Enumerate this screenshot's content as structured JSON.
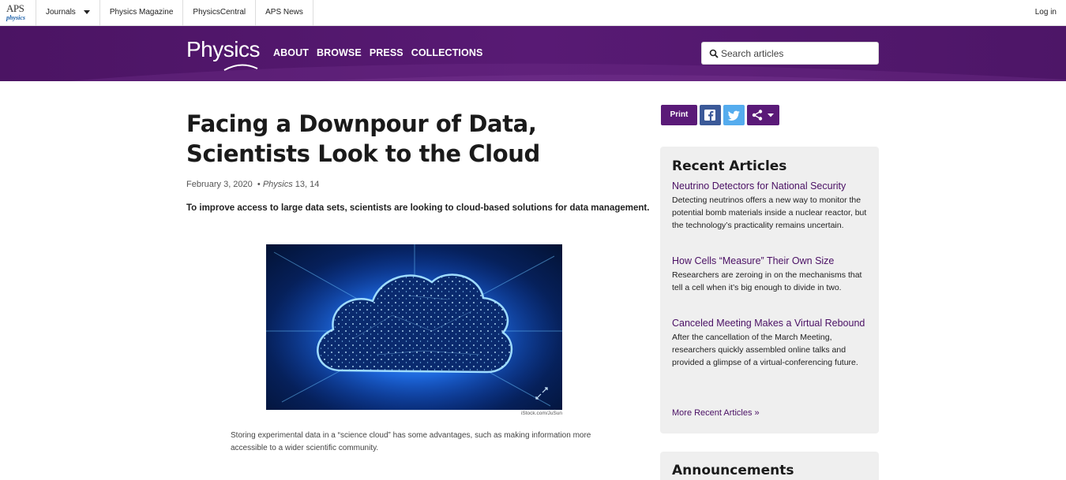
{
  "topbar": {
    "logo_aps": "APS",
    "logo_sub": "physics",
    "nav": [
      "Journals",
      "Physics Magazine",
      "PhysicsCentral",
      "APS News"
    ],
    "login": "Log in"
  },
  "header": {
    "brand": "Physics",
    "nav": [
      "ABOUT",
      "BROWSE",
      "PRESS",
      "COLLECTIONS"
    ],
    "search_placeholder": "Search articles",
    "search_icon": "search-icon"
  },
  "article": {
    "title": "Facing a Downpour of Data, Scientists Look to the Cloud",
    "date": "February 3, 2020",
    "journal": "Physics",
    "volume": "13, 14",
    "summary": "To improve access to large data sets, scientists are looking to cloud-based solutions for data management.",
    "image_credit": "iStock.com/JuSun",
    "caption": "Storing experimental data in a “science cloud” has some advantages, such as making information more accessible to a wider scientific community."
  },
  "share": {
    "print_label": "Print",
    "icons": [
      "facebook-icon",
      "twitter-icon",
      "share-icon"
    ]
  },
  "sidebar": {
    "recent_heading": "Recent Articles",
    "recent": [
      {
        "title": "Neutrino Detectors for National Security",
        "text": "Detecting neutrinos offers a new way to monitor the potential bomb materials inside a nuclear reactor, but the technology’s practicality remains uncertain."
      },
      {
        "title": "How Cells “Measure” Their Own Size",
        "text": "Researchers are zeroing in on the mechanisms that tell a cell when it’s big enough to divide in two."
      },
      {
        "title": "Canceled Meeting Makes a Virtual Rebound",
        "text": "After the cancellation of the March Meeting, researchers quickly assembled online talks and provided a glimpse of a virtual-conferencing future."
      }
    ],
    "more_recent": "More Recent Articles »",
    "announcements_heading": "Announcements"
  },
  "colors": {
    "brand_purple": "#581a74",
    "link_purple": "#4a1064",
    "facebook": "#3b5998",
    "twitter": "#55acee"
  }
}
